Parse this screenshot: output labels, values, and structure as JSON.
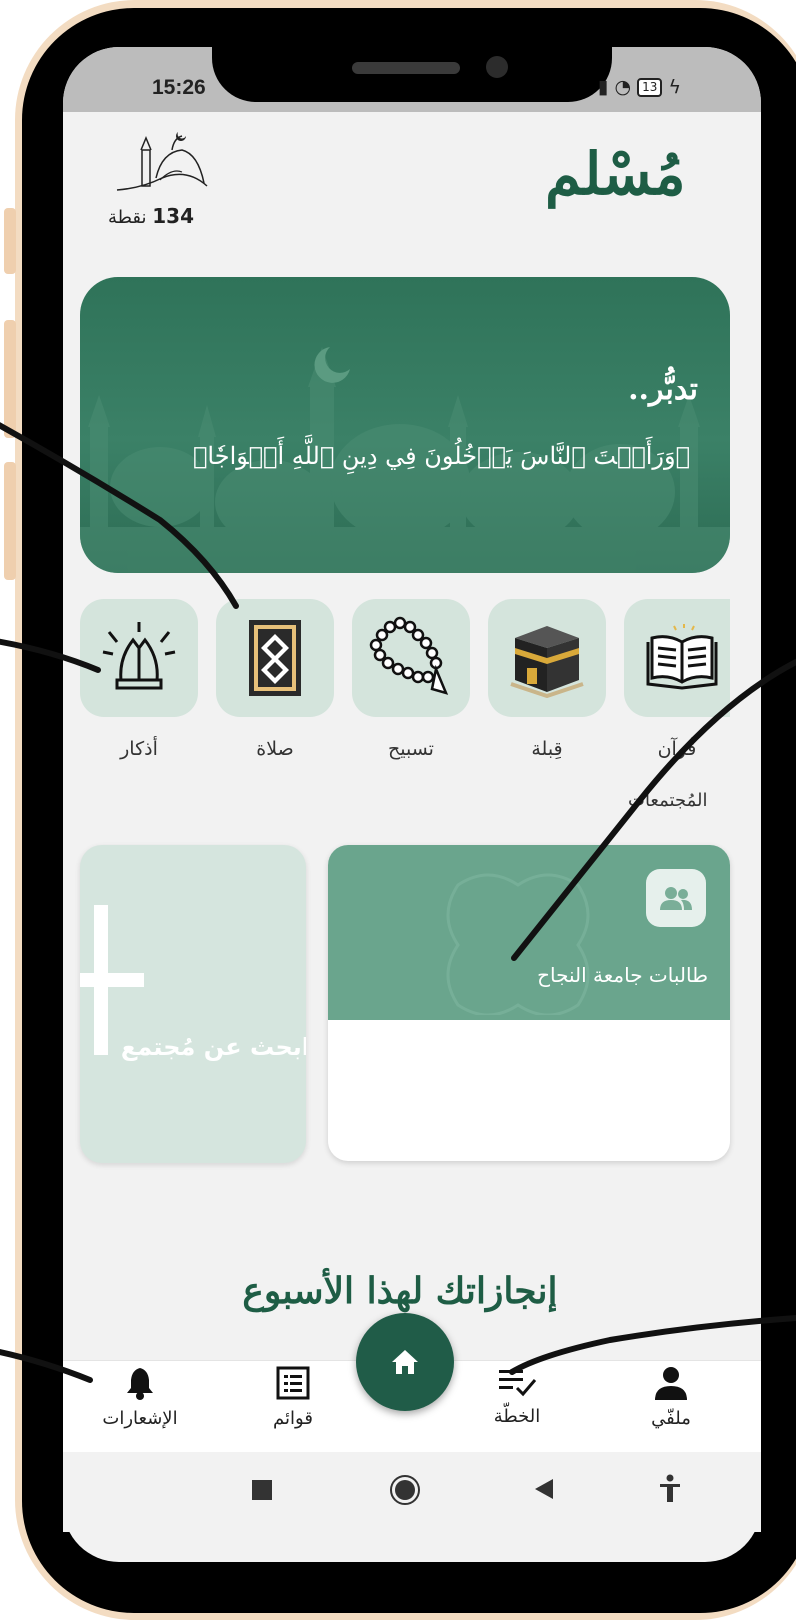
{
  "status_bar": {
    "time": "15:26",
    "battery": "13"
  },
  "header": {
    "app_title": "مُسْلم",
    "points_value": "134",
    "points_unit": "نقطة"
  },
  "banner": {
    "title": "تدبُّر..",
    "verse": "﴿وَرَأَيۡتَ ٱلنَّاسَ يَدۡخُلُونَ فِي دِينِ ٱللَّهِ أَفۡوَاجٗا﴾"
  },
  "shortcuts": [
    {
      "label": "أذكار",
      "icon": "praying-hands-icon"
    },
    {
      "label": "صلاة",
      "icon": "prayer-rug-icon"
    },
    {
      "label": "تسبيح",
      "icon": "prayer-beads-icon"
    },
    {
      "label": "قِبلة",
      "icon": "kaaba-icon"
    },
    {
      "label": "قُرآن",
      "icon": "quran-icon"
    }
  ],
  "communities": {
    "section_label": "المُجتمعات",
    "group_name": "طالبات جامعة النجاح",
    "search_label": "ابحث عن مُجتمع"
  },
  "achievements_title": "إنجازاتك لهذا الأسبوع",
  "bottom_nav": {
    "notifications": "الإشعارات",
    "lists": "قوائم",
    "plan": "الخطّة",
    "profile": "ملفّي"
  },
  "colors": {
    "primary": "#1e5d45",
    "banner": "#3b8167",
    "tile": "#d4e4dc",
    "card_header": "#6aa58d"
  }
}
